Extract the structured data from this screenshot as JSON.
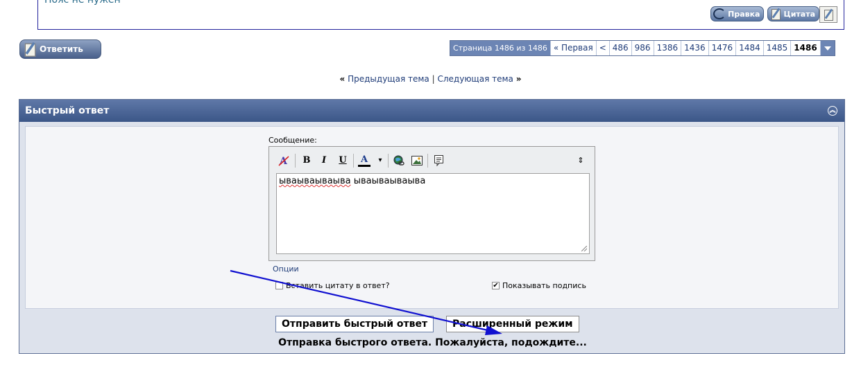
{
  "post": {
    "text": "Пояс не нужен",
    "edit_label": "Правка",
    "quote_label": "Цитата"
  },
  "reply_button": "Ответить",
  "pagination": {
    "label": "Страница 1486 из 1486",
    "first": "« Первая",
    "prev": "<",
    "pages": [
      "486",
      "986",
      "1386",
      "1436",
      "1476",
      "1484",
      "1485"
    ],
    "current": "1486"
  },
  "topic_nav": {
    "prev_arrow": "«",
    "prev": "Предыдущая тема",
    "sep": "|",
    "next": "Следующая тема",
    "next_arrow": "»"
  },
  "quick_reply": {
    "title": "Быстрый ответ",
    "message_label": "Сообщение:",
    "editor_word1": "ываываываыва",
    "editor_word2": " ываываываыва",
    "options_link": "Опции",
    "quote_checkbox_label": "Вставить цитату в ответ?",
    "quote_checked": false,
    "signature_checkbox_label": "Показывать подпись",
    "signature_checked": true,
    "send_button": "Отправить быстрый ответ",
    "advanced_button": "Расширенный режим",
    "status": "Отправка быстрого ответа. Пожалуйста, подождите..."
  },
  "toolbar": {
    "bold": "B",
    "italic": "I",
    "underline": "U",
    "font_color": "A",
    "dropdown": "▾",
    "expand": "⇕",
    "icons": [
      "remove-format-icon",
      "bold-icon",
      "italic-icon",
      "underline-icon",
      "font-color-icon",
      "link-icon",
      "image-icon",
      "quote-icon",
      "resize-editor-icon"
    ]
  },
  "colors": {
    "header": "#3b5688",
    "pagination_label": "#6c85b4",
    "link": "#1f3c78",
    "arrow": "#1010d0"
  }
}
